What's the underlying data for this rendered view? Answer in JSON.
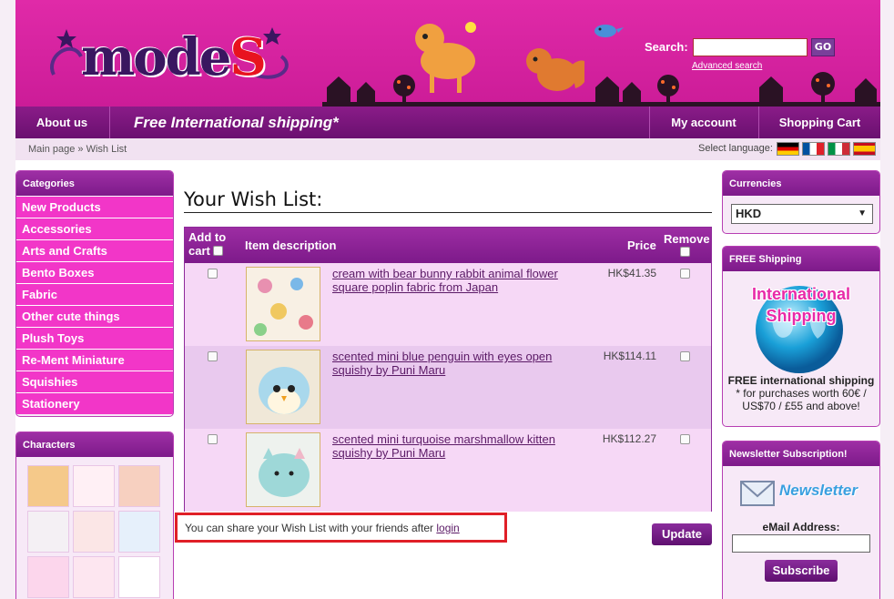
{
  "header": {
    "logo_text_a": "mode",
    "logo_text_b": "S",
    "search_label": "Search:",
    "search_value": "",
    "search_go": "GO",
    "advanced_search": "Advanced search"
  },
  "nav": {
    "about": "About us",
    "free_shipping": "Free International shipping*",
    "account": "My account",
    "cart": "Shopping Cart"
  },
  "breadcrumb": {
    "text": "Main page » Wish List",
    "select_language": "Select language:"
  },
  "categories": {
    "title": "Categories",
    "items": [
      "New Products",
      "Accessories",
      "Arts and Crafts",
      "Bento Boxes",
      "Fabric",
      "Other cute things",
      "Plush Toys",
      "Re-Ment Miniature",
      "Squishies",
      "Stationery"
    ]
  },
  "characters": {
    "title": "Characters"
  },
  "wishlist": {
    "title": "Your Wish List:",
    "col_add": "Add to cart",
    "col_desc": "Item description",
    "col_price": "Price",
    "col_remove": "Remove",
    "rows": [
      {
        "desc": "cream with bear bunny rabbit animal flower square poplin fabric from Japan",
        "price": "HK$41.35"
      },
      {
        "desc": "scented mini blue penguin with eyes open squishy by Puni Maru",
        "price": "HK$114.11"
      },
      {
        "desc": "scented mini turquoise marshmallow kitten squishy by Puni Maru",
        "price": "HK$112.27"
      }
    ],
    "share_text": "You can share your Wish List with your friends after ",
    "share_login": "login",
    "update": "Update"
  },
  "currencies": {
    "title": "Currencies",
    "selected": "HKD"
  },
  "free_shipping_box": {
    "title": "FREE Shipping",
    "banner_line1": "International",
    "banner_line2": "Shipping",
    "text_bold": "FREE international shipping",
    "text_rest": "* for purchases worth 60€ / US$70 / £55 and above!"
  },
  "newsletter": {
    "title": "Newsletter Subscription!",
    "logo_text": "Newsletter",
    "email_label": "eMail Address:",
    "email_value": "",
    "button": "Subscribe"
  },
  "colors": {
    "brand_magenta": "#e02aa8",
    "nav_purple": "#7d1a8a",
    "category_pink": "#f236c8",
    "highlight_red": "#e01f27"
  }
}
